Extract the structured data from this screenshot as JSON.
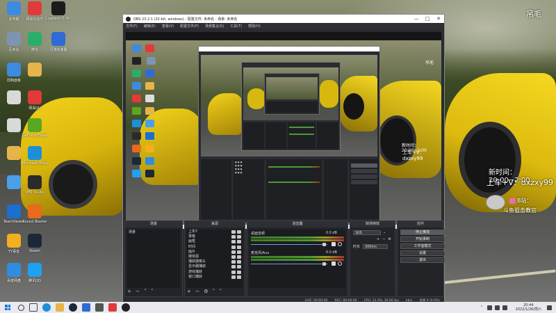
{
  "desktop": {
    "icons": [
      {
        "label": "此电脑",
        "color": "#3d8be0",
        "glyph": "monitor-icon"
      },
      {
        "label": "网易云音乐",
        "color": "#e13a3a",
        "glyph": "netease-icon"
      },
      {
        "label": "Logitech G HUB",
        "color": "#1b1b1b",
        "glyph": "g-hub-icon"
      },
      {
        "label": "回收站",
        "color": "#7d94b3",
        "glyph": "recycle-bin-icon"
      },
      {
        "label": "微信",
        "color": "#2aae67",
        "glyph": "wechat-icon"
      },
      {
        "label": "迅游加速器",
        "color": "#2f6ad6",
        "glyph": "booster-icon"
      },
      {
        "label": "控制面板",
        "color": "#3d8be0",
        "glyph": "control-panel-icon"
      },
      {
        "label": "",
        "color": "#e8b44a",
        "glyph": "folder-icon"
      },
      {
        "label": "",
        "color": "#d9d9d9",
        "glyph": "file-icon"
      },
      {
        "label": "网易UU",
        "color": "#e13a3a",
        "glyph": "uu-icon"
      },
      {
        "label": "",
        "color": "#d9d9d9",
        "glyph": "file-icon"
      },
      {
        "label": "GeForce Experience",
        "color": "#5aa820",
        "glyph": "nvidia-icon"
      },
      {
        "label": "",
        "color": "#e8b44a",
        "glyph": "folder-icon"
      },
      {
        "label": "Microsoft Edge",
        "color": "#1c8fd8",
        "glyph": "edge-icon"
      },
      {
        "label": "",
        "color": "#4aa0e8",
        "glyph": "weather-icon"
      },
      {
        "label": "OBS Studio",
        "color": "#2b2b2b",
        "glyph": "obs-icon"
      },
      {
        "label": "TeamViewer",
        "color": "#1a6fd0",
        "glyph": "teamviewer-icon"
      },
      {
        "label": "Sound Blaster",
        "color": "#e86a1a",
        "glyph": "sound-icon"
      },
      {
        "label": "YY语音",
        "color": "#f2b01e",
        "glyph": "yy-icon"
      },
      {
        "label": "Steam",
        "color": "#1b2838",
        "glyph": "steam-icon"
      },
      {
        "label": "百度网盘",
        "color": "#2f8de0",
        "glyph": "baidu-netdisk-icon"
      },
      {
        "label": "腾讯QQ",
        "color": "#1ea1f2",
        "glyph": "qq-icon"
      },
      {
        "label": "英雄联盟",
        "color": "#1a2838",
        "glyph": "lol-icon"
      }
    ],
    "overlay_title": "吊毛",
    "overlay_time": "新时间：20:00~2:00",
    "overlay_contact": "上车+V：dxzxy99",
    "overlay_station": "B站：",
    "overlay_group": "斗鱼狙击教官"
  },
  "obs": {
    "title": "OBS 23.2.1 (32-bit, windows) - 配置文件: 未命名 - 场景: 未命名",
    "menu": [
      "文件(F)",
      "编辑(E)",
      "查看(V)",
      "配置文件(P)",
      "场景集合(S)",
      "工具(T)",
      "帮助(H)"
    ],
    "preview": {
      "title": "吊毛",
      "time_line": "新时间：20:00~2:00",
      "contact_line": "上车+V：dxzxy99"
    },
    "docks": {
      "scenes": {
        "title": "场景",
        "items": [
          "场景"
        ]
      },
      "sources": {
        "title": "来源",
        "items": [
          "上车Y",
          "录像",
          "画框",
          "时间",
          "画片",
          "媒体源",
          "捕获摄像头",
          "显示器捕获",
          "游戏捕获",
          "窗口捕获"
        ]
      },
      "mixer": {
        "title": "混音器",
        "tracks": [
          {
            "name": "桌面音频",
            "db": "0.0 dB",
            "level": 0.98
          },
          {
            "name": "麦克风/Aux",
            "db": "0.0 dB",
            "level": 0.98
          }
        ]
      },
      "transitions": {
        "title": "转场特效",
        "type": "淡出",
        "duration_label": "时长",
        "duration": "300ms"
      },
      "controls": {
        "title": "控件",
        "buttons": [
          "停止推流",
          "开始录制",
          "工作室模式",
          "设置",
          "退出"
        ]
      }
    },
    "status": {
      "live": "LIVE: 00:00:00",
      "rec": "REC: 00:00:00",
      "cpu": "CPU: 12.0%, 30.00 fps",
      "bitrate": "kb/s",
      "dropped": "丢帧 0 (0.0%)"
    }
  },
  "taskbar": {
    "time": "20:44",
    "date": "2022/1/26/周六"
  }
}
